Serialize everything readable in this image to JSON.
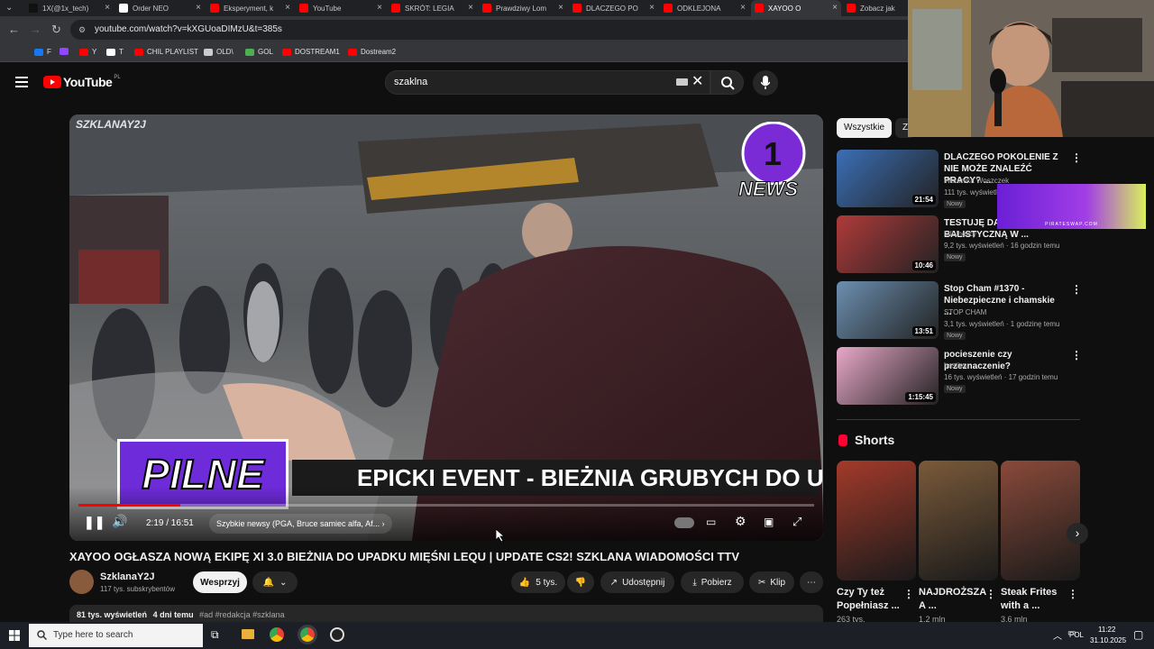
{
  "tabs": [
    {
      "label": "1X(@1x_tech)",
      "color": "#111111"
    },
    {
      "label": "Order NEO",
      "color": "#ffffff"
    },
    {
      "label": "Eksperyment, k",
      "color": "#ff0000"
    },
    {
      "label": "YouTube",
      "color": "#ff0000"
    },
    {
      "label": "SKRÓT: LEGIA",
      "color": "#ff0000"
    },
    {
      "label": "Prawdziwy Lom",
      "color": "#ff0000"
    },
    {
      "label": "DLACZEGO PO",
      "color": "#ff0000"
    },
    {
      "label": "ODKLEJONA",
      "color": "#ff0000"
    },
    {
      "label": "XAYOO O",
      "color": "#ff0000"
    },
    {
      "label": "Zobacz jak",
      "color": "#ff0000"
    }
  ],
  "browser": {
    "url": "youtube.com/watch?v=kXGUoaDIMzU&t=385s"
  },
  "bookmarks": [
    {
      "label": "F",
      "color": "#1877f2"
    },
    {
      "label": "",
      "color": "#9146ff"
    },
    {
      "label": "Y",
      "color": "#ff0000"
    },
    {
      "label": "T",
      "color": "#ffffff"
    },
    {
      "label": "CHIL PLAYLIST",
      "color": "#ff0000"
    },
    {
      "label": "OLD\\",
      "color": "#cccccc"
    },
    {
      "label": "GOL",
      "color": "#4caf50"
    },
    {
      "label": "DOSTREAM1",
      "color": "#ff0000"
    },
    {
      "label": "Dostream2",
      "color": "#ff0000"
    }
  ],
  "yt": {
    "logo": "YouTube",
    "region": "PL",
    "search_query": "szaklna"
  },
  "player": {
    "watermark": "SZKLANAY2J",
    "news_badge": "NEWS",
    "pilne": "PILNE",
    "banner": "EPICKI EVENT - BIEŻNIA GRUBYCH DO UPAD",
    "time": "2:19 / 16:51",
    "chapter": "Szybkie newsy (PGA, Bruce samiec alfa, Af...",
    "progress": 0.138
  },
  "video": {
    "title": "XAYOO OGŁASZA NOWĄ EKIPĘ XI 3.0 BIEŻNIA DO UPADKU MIĘŚNI LEQU | UPDATE CS2! SZKLANA WIADOMOŚCI TTV",
    "channel": "SzklanaY2J",
    "subscribers": "117 tys. subskrybentów",
    "support": "Wesprzyj",
    "likes": "5 tys.",
    "share": "Udostępnij",
    "download": "Pobierz",
    "clip": "Klip",
    "views": "81 tys. wyświetleń",
    "date": "4 dni temu",
    "tags": "#ad #redakcja #szklana"
  },
  "sidebar": {
    "chips": [
      "Wszystkie",
      "Z"
    ],
    "recommended": [
      {
        "title": "DLACZEGO POKOLENIE Z NIE MOŻE ZNALEŹĆ PRACY? ...",
        "channel": "Weronika Woszczek",
        "meta": "111 tys. wyświetleń",
        "badge": "Nowy",
        "duration": "21:54",
        "thumb_color": "#3b6fb6"
      },
      {
        "title": "TESTUJĘ DAMSKĄ BALISTYCZNĄ W ...",
        "channel": "MILIholicy",
        "meta": "9,2 tys. wyświetleń · 16 godzin temu",
        "badge": "Nowy",
        "duration": "10:46",
        "thumb_color": "#b03a3a"
      },
      {
        "title": "Stop Cham #1370 - Niebezpieczne i chamskie ...",
        "channel": "STOP CHAM",
        "meta": "3,1 tys. wyświetleń · 1 godzinę temu",
        "badge": "Nowy",
        "duration": "13:51",
        "thumb_color": "#6c8fb0"
      },
      {
        "title": "pocieszenie czy przeznaczenie?",
        "channel": "besties",
        "meta": "16 tys. wyświetleń · 17 godzin temu",
        "badge": "Nowy",
        "duration": "1:15:45",
        "thumb_color": "#e8a8c8"
      }
    ],
    "shorts_heading": "Shorts",
    "shorts": [
      {
        "title": "Czy Ty też Popełniasz ...",
        "views": "263 tys.",
        "color": "#a33a2a"
      },
      {
        "title": "NAJDROŻSZA A ...",
        "views": "1,2 mln",
        "color": "#7a5a3a"
      },
      {
        "title": "Steak Frites with a ...",
        "views": "3,6 mln",
        "color": "#8a4a3a"
      }
    ],
    "ad_text": "PIRATESWAP.COM"
  },
  "taskbar": {
    "search_placeholder": "Type here to search",
    "lang": "POL",
    "time": "11:22",
    "date": "31.10.2025"
  }
}
